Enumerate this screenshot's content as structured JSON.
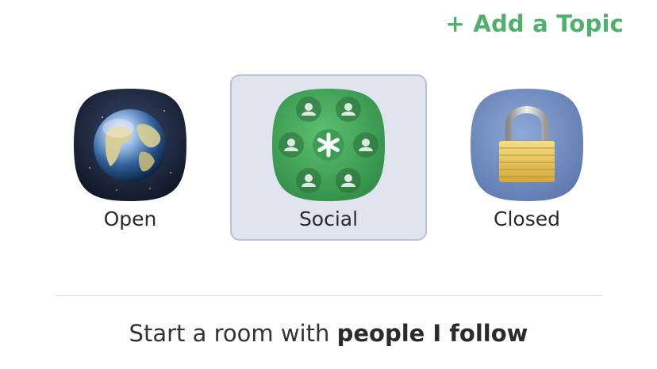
{
  "header": {
    "add_topic_label": "+ Add a Topic"
  },
  "room_types": [
    {
      "label": "Open",
      "icon": "globe-icon",
      "selected": false
    },
    {
      "label": "Social",
      "icon": "social-icon",
      "selected": true
    },
    {
      "label": "Closed",
      "icon": "lock-icon",
      "selected": false
    }
  ],
  "footer": {
    "start_prefix": "Start a room with ",
    "start_bold": "people I follow"
  },
  "colors": {
    "accent": "#4fb06b",
    "selected_bg": "#dfe4ee",
    "selected_border": "#b8c3d8"
  }
}
